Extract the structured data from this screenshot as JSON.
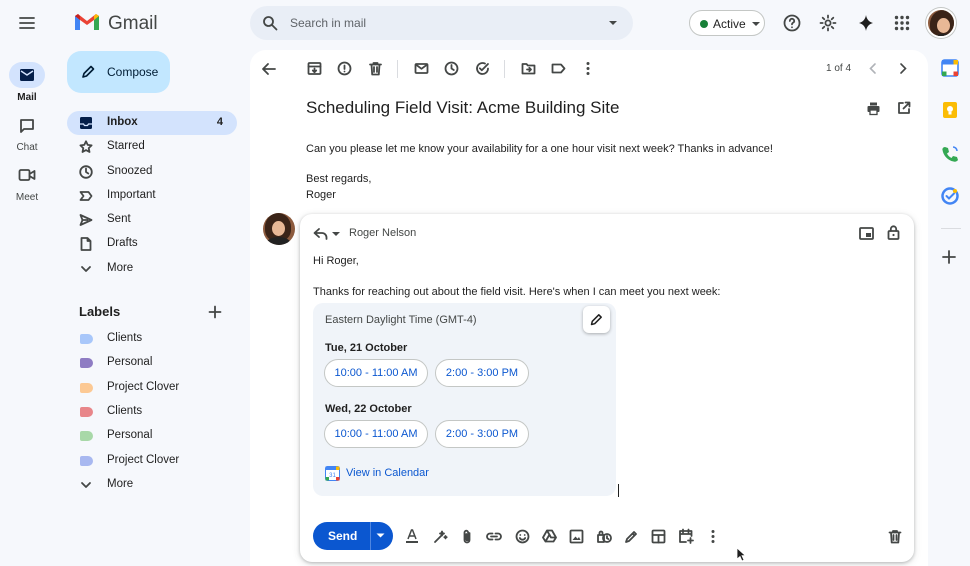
{
  "header": {
    "app_name": "Gmail",
    "search_placeholder": "Search in mail",
    "status_label": "Active"
  },
  "rail": {
    "items": [
      {
        "label": "Mail"
      },
      {
        "label": "Chat"
      },
      {
        "label": "Meet"
      }
    ]
  },
  "sidebar": {
    "compose_label": "Compose",
    "nav": [
      {
        "label": "Inbox",
        "count": "4"
      },
      {
        "label": "Starred"
      },
      {
        "label": "Snoozed"
      },
      {
        "label": "Important"
      },
      {
        "label": "Sent"
      },
      {
        "label": "Drafts"
      },
      {
        "label": "More"
      }
    ],
    "labels_title": "Labels",
    "labels": [
      {
        "label": "Clients",
        "color": "#a8c7fa"
      },
      {
        "label": "Personal",
        "color": "#8e7cc3"
      },
      {
        "label": "Project Clover",
        "color": "#fcc994"
      },
      {
        "label": "Clients",
        "color": "#e8868a"
      },
      {
        "label": "Personal",
        "color": "#a8d8a8"
      },
      {
        "label": "Project Clover",
        "color": "#a8b8f0"
      }
    ],
    "labels_more": "More"
  },
  "toolbar": {
    "pager": "1 of 4"
  },
  "email": {
    "subject": "Scheduling Field Visit: Acme Building Site",
    "body": "Can you please let me know your availability for a one hour visit next week? Thanks in advance!",
    "closing": "Best regards,",
    "signature": "Roger"
  },
  "reply": {
    "recipient": "Roger Nelson",
    "greeting": "Hi Roger,",
    "intro": "Thanks for reaching out about the field visit. Here's when I can meet you next week:",
    "timezone": "Eastern Daylight Time (GMT-4)",
    "days": [
      {
        "date": "Tue, 21 October",
        "slots": [
          "10:00 - 11:00 AM",
          "2:00 - 3:00 PM"
        ]
      },
      {
        "date": "Wed, 22 October",
        "slots": [
          "10:00 - 11:00 AM",
          "2:00 - 3:00 PM"
        ]
      }
    ],
    "view_calendar": "View in Calendar",
    "send_label": "Send"
  }
}
